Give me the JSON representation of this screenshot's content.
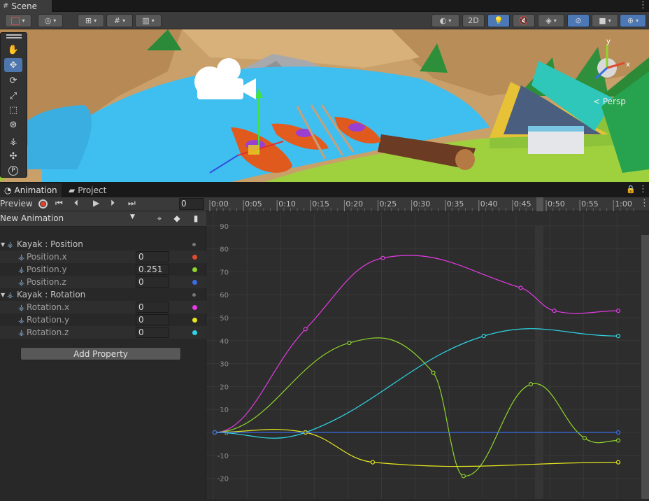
{
  "scene_tab": {
    "title": "Scene"
  },
  "scene_toolbar": {
    "mode_2d": "2D"
  },
  "viewport": {
    "persp_label": "< Persp",
    "gizmo_axis_y": "y",
    "gizmo_axis_x": "x"
  },
  "anim_tabs": [
    {
      "label": "Animation"
    },
    {
      "label": "Project"
    }
  ],
  "anim_toolbar": {
    "preview": "Preview",
    "frame": "0"
  },
  "clip": {
    "name": "New Animation"
  },
  "timeline": {
    "ticks": [
      "0:00",
      "0:05",
      "0:10",
      "0:15",
      "0:20",
      "0:25",
      "0:30",
      "0:35",
      "0:40",
      "0:45",
      "0:50",
      "0:55",
      "1:00"
    ]
  },
  "properties": [
    {
      "label": "Kayak : Position",
      "group": true
    },
    {
      "label": "Position.x",
      "value": "0",
      "color": "#e04a2f"
    },
    {
      "label": "Position.y",
      "value": "0.251",
      "color": "#8fd52c"
    },
    {
      "label": "Position.z",
      "value": "0",
      "color": "#3b6de6"
    },
    {
      "label": "Kayak : Rotation",
      "group": true
    },
    {
      "label": "Rotation.x",
      "value": "0",
      "color": "#e43be4"
    },
    {
      "label": "Rotation.y",
      "value": "0",
      "color": "#e6e61e"
    },
    {
      "label": "Rotation.z",
      "value": "0",
      "color": "#2ed4e4"
    }
  ],
  "add_property": "Add Property",
  "chart_data": {
    "type": "line",
    "ylim": [
      -22,
      91
    ],
    "xlim": [
      0,
      60
    ],
    "yticks": [
      "90",
      "80",
      "70",
      "60",
      "50",
      "40",
      "30",
      "20",
      "10",
      "0",
      "-10",
      "-20"
    ],
    "series": [
      {
        "color": "#e43be4",
        "x": [
          0,
          13.5,
          25,
          45.5,
          50.5,
          60
        ],
        "y": [
          0,
          45,
          76,
          63,
          53,
          53
        ]
      },
      {
        "color": "#8fd52c",
        "x": [
          0,
          20,
          32.5,
          37,
          47,
          55,
          60
        ],
        "y": [
          0,
          39,
          26,
          -19,
          21,
          -2.5,
          -3.5
        ]
      },
      {
        "color": "#2ed4e4",
        "x": [
          0,
          13.5,
          40,
          60
        ],
        "y": [
          0,
          0,
          42,
          42
        ]
      },
      {
        "color": "#e6e61e",
        "x": [
          0,
          13.5,
          23.5,
          60
        ],
        "y": [
          0,
          0,
          -13,
          -13
        ]
      },
      {
        "color": "#3b6de6",
        "x": [
          0,
          60
        ],
        "y": [
          0,
          0
        ]
      }
    ]
  }
}
